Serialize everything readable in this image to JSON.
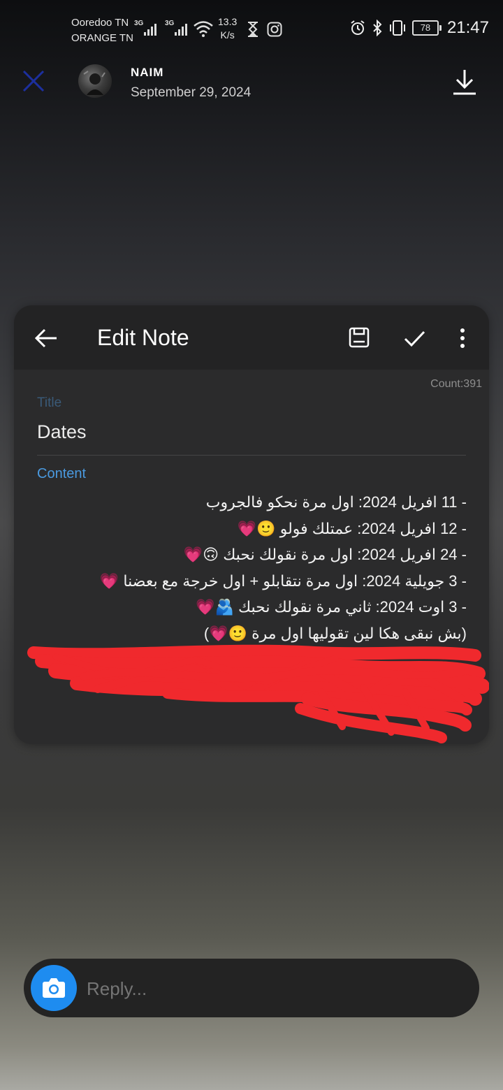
{
  "status_bar": {
    "carrier_1": "Ooredoo TN",
    "carrier_2": "ORANGE TN",
    "network_1": "3G",
    "network_2": "3G",
    "speed_value": "13.3",
    "speed_unit": "K/s",
    "battery": "78",
    "time": "21:47",
    "icons": [
      "signal-icon",
      "wifi-icon",
      "hourglass-icon",
      "instagram-icon",
      "alarm-icon",
      "bluetooth-icon",
      "vibrate-icon",
      "battery-icon"
    ]
  },
  "header": {
    "sender": "NAIM",
    "date": "September 29, 2024"
  },
  "note": {
    "appbar_title": "Edit Note",
    "count": "Count:391",
    "title_label": "Title",
    "title_value": "Dates",
    "content_label": "Content",
    "lines": [
      "- 11 افريل 2024: اول مرة نحكو فالجروب",
      "- 12 افريل 2024: عمتلك فولو 🙂💗",
      "- 24 افريل 2024: اول مرة نقولك نحبك 🙃💗",
      "- 3 جويلية 2024: اول مرة نتقابلو + اول خرجة مع بعضنا 💗",
      "- 3 اوت 2024: ثاني مرة نقولك نحبك 🫂💗",
      "(بش نبقى هكا لين تقوليها اول مرة 🙂💗)"
    ],
    "redaction_color": "#f0292d"
  },
  "reply": {
    "placeholder": "Reply..."
  },
  "colors": {
    "accent_blue": "#1e8cf0",
    "content_label_blue": "#4a9ae0",
    "close_x_blue": "#1c2f9e"
  }
}
